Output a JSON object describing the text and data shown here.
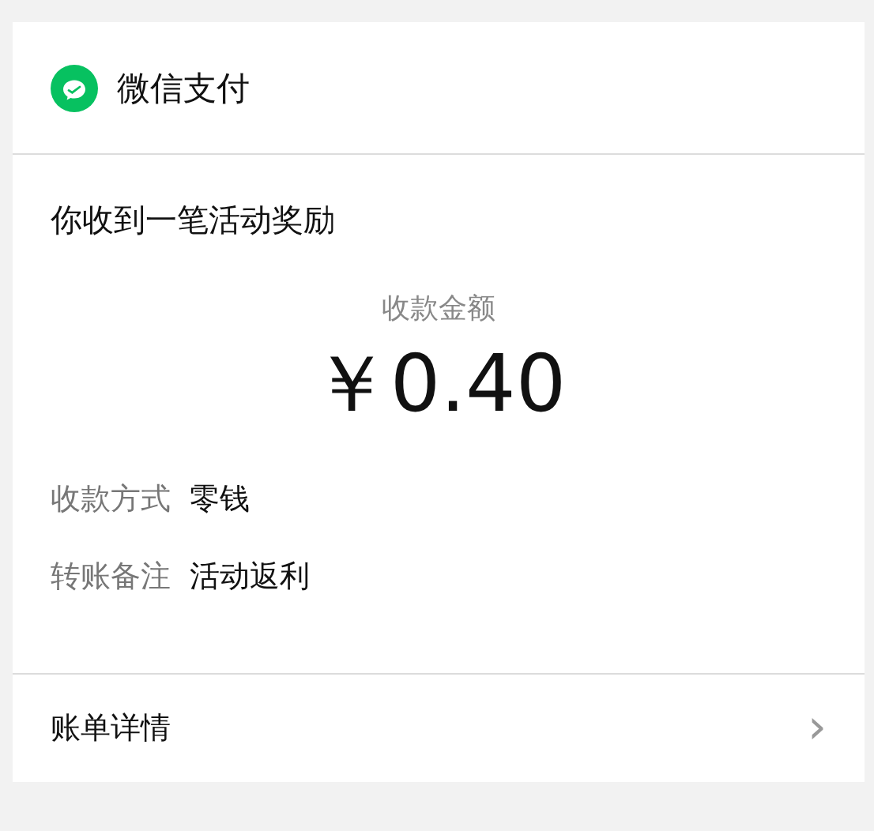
{
  "header": {
    "title": "微信支付"
  },
  "message": {
    "title": "你收到一笔活动奖励",
    "amount_label": "收款金额",
    "amount": "￥0.40"
  },
  "details": [
    {
      "label": "收款方式",
      "value": "零钱"
    },
    {
      "label": "转账备注",
      "value": "活动返利"
    }
  ],
  "footer": {
    "link": "账单详情",
    "chevron": "›"
  }
}
